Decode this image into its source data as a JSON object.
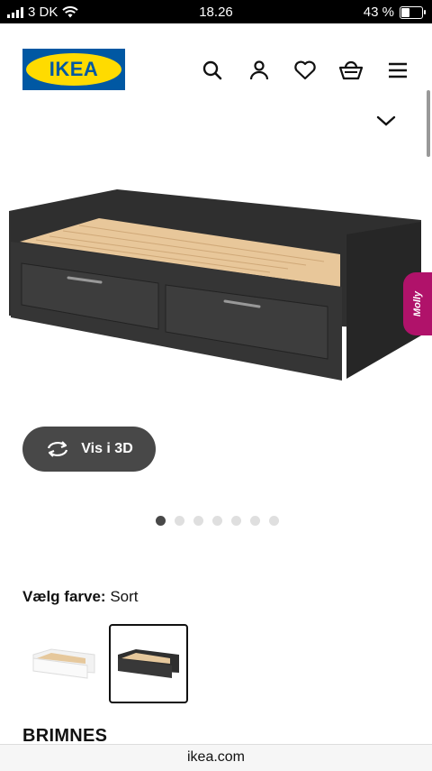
{
  "status_bar": {
    "carrier": "3 DK",
    "time": "18.26",
    "battery": "43 %",
    "battery_level": 0.43
  },
  "header": {
    "logo_text": "IKEA",
    "icons": [
      "search-icon",
      "account-icon",
      "heart-icon",
      "basket-icon",
      "menu-icon",
      "chevron-down-icon"
    ]
  },
  "assistant": {
    "label": "Molly"
  },
  "view3d": {
    "label": "Vis i 3D",
    "icon": "rotate-icon"
  },
  "carousel": {
    "total": 7,
    "active": 1
  },
  "color_select": {
    "label": "Vælg farve:",
    "value": "Sort",
    "options": [
      "white",
      "black"
    ],
    "selected_index": 1
  },
  "product": {
    "name": "BRIMNES"
  },
  "browser": {
    "url": "ikea.com"
  },
  "colors": {
    "ikea_blue": "#0058a3",
    "ikea_yellow": "#ffdb00",
    "molly_pink": "#b0126a",
    "button_dark": "#484848"
  }
}
